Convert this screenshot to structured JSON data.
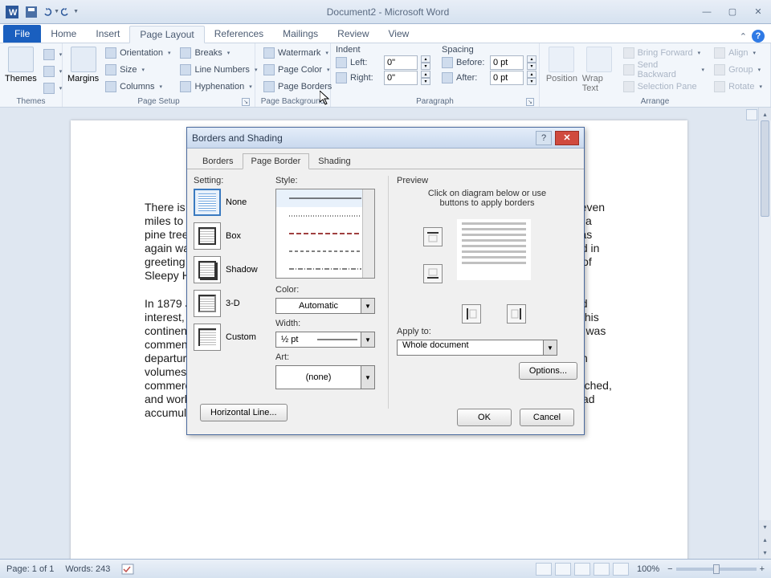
{
  "app": {
    "title": "Document2 - Microsoft Word"
  },
  "tabs": {
    "file": "File",
    "home": "Home",
    "insert": "Insert",
    "pageLayout": "Page Layout",
    "references": "References",
    "mailings": "Mailings",
    "review": "Review",
    "view": "View"
  },
  "ribbon": {
    "themes": {
      "label": "Themes",
      "big": "Themes"
    },
    "pageSetup": {
      "label": "Page Setup",
      "margins": "Margins",
      "orientation": "Orientation",
      "size": "Size",
      "columns": "Columns",
      "breaks": "Breaks",
      "lineNumbers": "Line Numbers",
      "hyphenation": "Hyphenation"
    },
    "pageBackground": {
      "label": "Page Background",
      "watermark": "Watermark",
      "pageColor": "Page Color",
      "pageBorders": "Page Borders"
    },
    "paragraph": {
      "label": "Paragraph",
      "indent": "Indent",
      "left": "Left:",
      "right": "Right:",
      "spacing": "Spacing",
      "before": "Before:",
      "after": "After:",
      "leftVal": "0\"",
      "rightVal": "0\"",
      "beforeVal": "0 pt",
      "afterVal": "0 pt"
    },
    "arrange": {
      "label": "Arrange",
      "position": "Position",
      "wrap": "Wrap Text",
      "bringForward": "Bring Forward",
      "sendBackward": "Send Backward",
      "selectionPane": "Selection Pane",
      "align": "Align",
      "group": "Group",
      "rotate": "Rotate"
    }
  },
  "document": {
    "p1": "There is a quiet little village on the Hudson River called Irvington. What a road. \"It was seven miles to travel in the morning,\" Douglas Irving said one day in 1906, as he passed under a pine tree — quite a distance even for a time spent in reflection and contemplation. He was again waving his handkerchief to the horseman. \"Shall we not go forward again?\" he said in greeting to the \"higher Spirit\" that same day, for now he had reached the stopping place of Sleepy Hollow and he chose to make it his final home.",
    "p2": "In 1879 John Jacob Astor helped Douglas start a sizable company. With his compounded interest, Douglas finally felt free to drop everything and sail for Europe. He remained on this continent for seventeen years. He became secretary of the American Legation, and then was commended to Madrid. A diplomatic stint as Minister to the Court of Spain prevented his departure from Europe. Douglas then visited the family homestead in Africa in 1912. Both volumes of his monumental Life of George Washington had been published by Putnam commercially. At long last he could settle down in the cottage he loved. He revised, retouched, and worked with loving care over the great mass of story, history, and biography which had accumulated under his hands for more than thirty years."
  },
  "dialog": {
    "title": "Borders and Shading",
    "tabs": {
      "borders": "Borders",
      "pageBorder": "Page Border",
      "shading": "Shading"
    },
    "settingLabel": "Setting:",
    "settings": {
      "none": "None",
      "box": "Box",
      "shadow": "Shadow",
      "threeD": "3-D",
      "custom": "Custom"
    },
    "styleLabel": "Style:",
    "colorLabel": "Color:",
    "colorVal": "Automatic",
    "widthLabel": "Width:",
    "widthVal": "½ pt",
    "artLabel": "Art:",
    "artVal": "(none)",
    "previewLabel": "Preview",
    "previewHint": "Click on diagram below or use buttons to apply borders",
    "applyLabel": "Apply to:",
    "applyVal": "Whole document",
    "options": "Options...",
    "horizLine": "Horizontal Line...",
    "ok": "OK",
    "cancel": "Cancel"
  },
  "status": {
    "page": "Page: 1 of 1",
    "words": "Words: 243",
    "zoom": "100%"
  }
}
